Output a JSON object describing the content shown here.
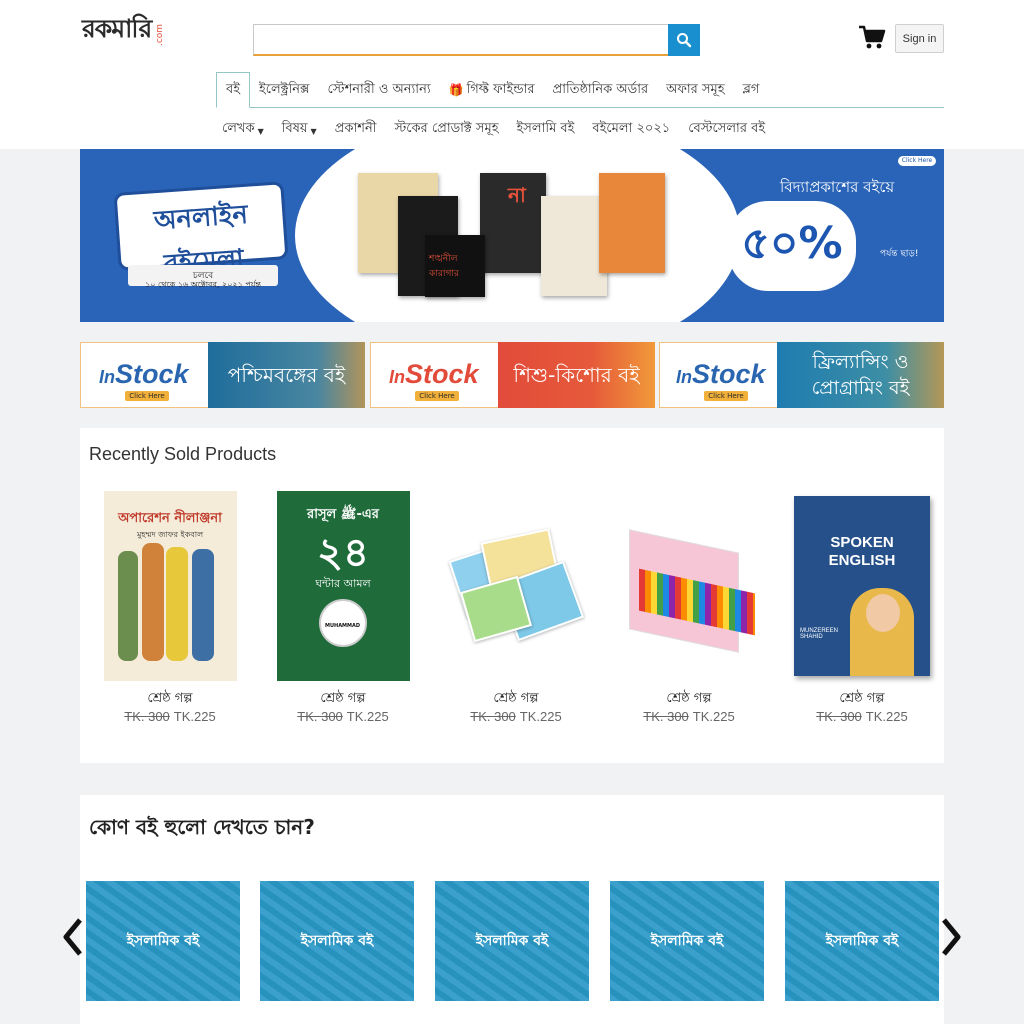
{
  "header": {
    "logo_text": "রকমারি",
    "logo_suffix": ".com",
    "search": {
      "placeholder": "",
      "value": ""
    },
    "signin_label": "Sign in"
  },
  "nav_primary": [
    {
      "label": "বই",
      "active": true
    },
    {
      "label": "ইলেক্ট্রনিক্স"
    },
    {
      "label": "স্টেশনারী ও অন্যান্য"
    },
    {
      "label": "গিফ্ট ফাইন্ডার",
      "icon": "gift-icon"
    },
    {
      "label": "প্রাতিষ্ঠানিক অর্ডার"
    },
    {
      "label": "অফার সমূহ"
    },
    {
      "label": "ব্লগ"
    }
  ],
  "nav_secondary": [
    {
      "label": "লেখক",
      "dropdown": true
    },
    {
      "label": "বিষয়",
      "dropdown": true
    },
    {
      "label": "প্রকাশনী"
    },
    {
      "label": "স্টকের প্রোডাক্ট সমূহ"
    },
    {
      "label": "ইসলামি বই"
    },
    {
      "label": "বইমেলা ২০২১"
    },
    {
      "label": "বেস্টসেলার বই"
    }
  ],
  "hero_banner": {
    "left_title": "অনলাইন বইমেলা",
    "date_label": "চলবে",
    "date_range": "১০ থেকে ১৬ অক্টোবর, ২০২১ পর্যন্ত",
    "right_title": "বিদ্যাপ্রকাশের বইয়ে",
    "discount": "৫০%",
    "discount_note": "পর্যন্ত ছাড়!",
    "click_here": "Click Here",
    "book_titles": [
      "না",
      "শঙ্খনীল কারাগার"
    ]
  },
  "promos": [
    {
      "badge_in": "In",
      "badge_stock": "Stock",
      "click": "Click Here",
      "title": "পশ্চিমবঙ্গের বই",
      "color": "#2a6f9a"
    },
    {
      "badge_in": "In",
      "badge_stock": "Stock",
      "click": "Click Here",
      "title": "শিশু-কিশোর বই",
      "color": "#e0553b"
    },
    {
      "badge_in": "In",
      "badge_stock": "Stock",
      "click": "Click Here",
      "title": "ফ্রিল্যান্সিং ও প্রোগ্রামিং বই",
      "color": "#2d7fa6"
    }
  ],
  "recent": {
    "title": "Recently Sold Products",
    "products": [
      {
        "name": "শ্রেষ্ঠ গল্প",
        "old_price": "TK. 300",
        "price": "TK.225",
        "cover_title": "অপারেশন নীলাঞ্জনা",
        "cover_author": "মুহম্মদ জাফর ইকবাল"
      },
      {
        "name": "শ্রেষ্ঠ গল্প",
        "old_price": "TK. 300",
        "price": "TK.225",
        "cover_title": "রাসূল ﷺ-এর",
        "cover_big": "২৪",
        "cover_sub": "ঘন্টার আমল",
        "cover_badge": "MUHAMMAD"
      },
      {
        "name": "শ্রেষ্ঠ গল্প",
        "old_price": "TK. 300",
        "price": "TK.225"
      },
      {
        "name": "শ্রেষ্ঠ গল্প",
        "old_price": "TK. 300",
        "price": "TK.225"
      },
      {
        "name": "শ্রেষ্ঠ গল্প",
        "old_price": "TK. 300",
        "price": "TK.225",
        "cover_title": "SPOKEN ENGLISH",
        "cover_author": "MUNZEREEN SHAHID"
      }
    ]
  },
  "categories": {
    "title": "কোণ বই হুলো দেখতে চান?",
    "items": [
      {
        "label": "ইসলামিক বই"
      },
      {
        "label": "ইসলামিক বই"
      },
      {
        "label": "ইসলামিক বই"
      },
      {
        "label": "ইসলামিক বই"
      },
      {
        "label": "ইসলামিক বই"
      }
    ]
  },
  "colors": {
    "accent_blue": "#1a8fd0",
    "hero_blue": "#2a64b8",
    "category_blue": "#2a98c7",
    "nav_border": "#93c6c4"
  }
}
